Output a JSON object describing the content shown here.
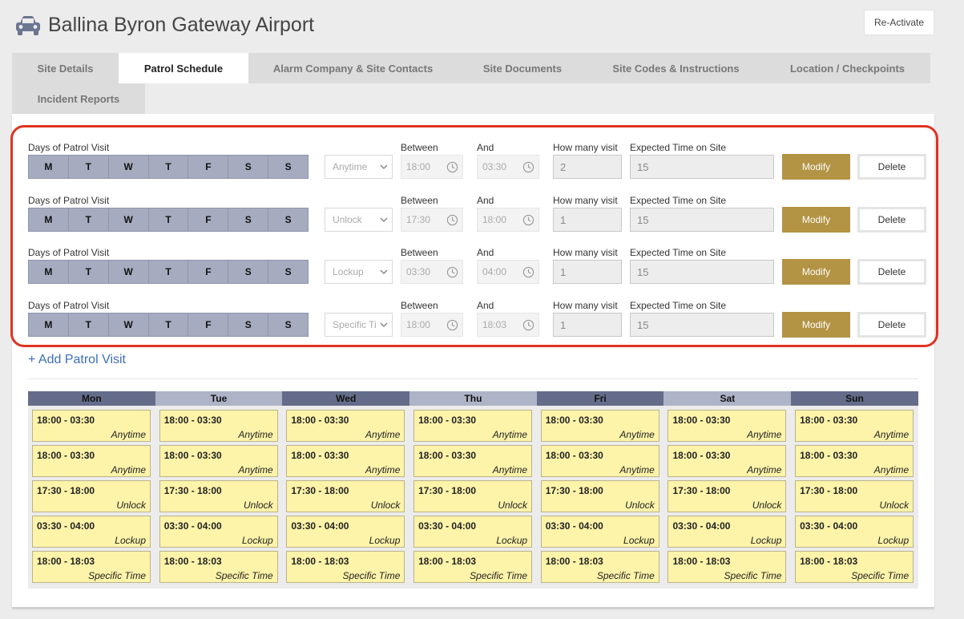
{
  "header": {
    "title": "Ballina Byron Gateway Airport",
    "reactivate_label": "Re-Activate"
  },
  "tabs": [
    {
      "label": "Site Details",
      "active": false
    },
    {
      "label": "Patrol Schedule",
      "active": true
    },
    {
      "label": "Alarm Company & Site Contacts",
      "active": false
    },
    {
      "label": "Site Documents",
      "active": false
    },
    {
      "label": "Site Codes & Instructions",
      "active": false
    },
    {
      "label": "Location / Checkpoints",
      "active": false
    },
    {
      "label": "Incident Reports",
      "active": false
    }
  ],
  "form_labels": {
    "days": "Days of Patrol Visit",
    "between": "Between",
    "and": "And",
    "visits": "How many visit",
    "expected": "Expected Time on Site"
  },
  "day_letters": [
    "M",
    "T",
    "W",
    "T",
    "F",
    "S",
    "S"
  ],
  "visits": [
    {
      "type": "Anytime",
      "between": "18:00",
      "and": "03:30",
      "count": "2",
      "expected": "15",
      "modify": "Modify",
      "delete": "Delete"
    },
    {
      "type": "Unlock",
      "between": "17:30",
      "and": "18:00",
      "count": "1",
      "expected": "15",
      "modify": "Modify",
      "delete": "Delete"
    },
    {
      "type": "Lockup",
      "between": "03:30",
      "and": "04:00",
      "count": "1",
      "expected": "15",
      "modify": "Modify",
      "delete": "Delete"
    },
    {
      "type": "Specific Ti",
      "between": "18:00",
      "and": "18:03",
      "count": "1",
      "expected": "15",
      "modify": "Modify",
      "delete": "Delete"
    }
  ],
  "add_visit_label": "+ Add Patrol Visit",
  "calendar": {
    "days": [
      "Mon",
      "Tue",
      "Wed",
      "Thu",
      "Fri",
      "Sat",
      "Sun"
    ],
    "events": [
      {
        "time": "18:00 - 03:30",
        "type": "Anytime"
      },
      {
        "time": "18:00 - 03:30",
        "type": "Anytime"
      },
      {
        "time": "17:30 - 18:00",
        "type": "Unlock"
      },
      {
        "time": "03:30 - 04:00",
        "type": "Lockup"
      },
      {
        "time": "18:00 - 18:03",
        "type": "Specific Time"
      }
    ]
  },
  "colors": {
    "accent_gold": "#b39344",
    "highlight_red": "#e03320",
    "day_button": "#a6abbf",
    "calendar_head_dark": "#656c8a",
    "calendar_head_light": "#aeb3c7",
    "event_bg": "#fdf3a9",
    "link_blue": "#3d6fb8"
  },
  "icons": {
    "header": "car-icon",
    "select": "chevron-down-icon",
    "time_field": "clock-icon"
  }
}
